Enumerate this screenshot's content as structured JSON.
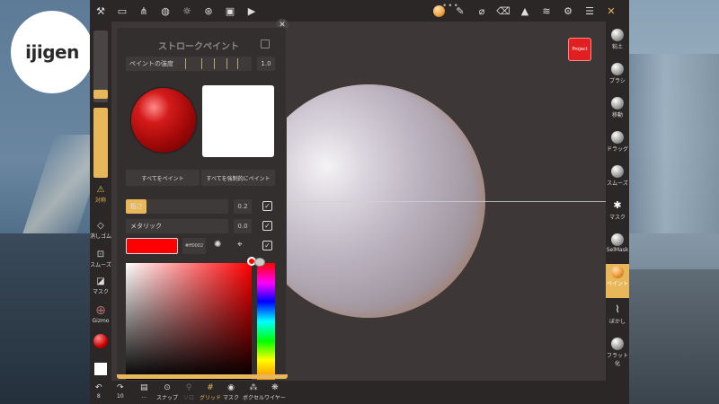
{
  "logo": {
    "text": "ijigen"
  },
  "topbar": {
    "icons": [
      "tools-icon",
      "folder-icon",
      "share-icon",
      "globe-icon",
      "sun-icon",
      "film-icon",
      "image-icon",
      "camera-icon"
    ],
    "right_icons": [
      "matcap-icon",
      "pen-icon",
      "pipette-icon",
      "trash-icon",
      "triangle-icon",
      "layers-icon",
      "gear-icon",
      "sliders-icon",
      "wand-icon"
    ],
    "more": "•••"
  },
  "viewport": {
    "project_label": "Project"
  },
  "panel": {
    "title": "ストロークペイント",
    "intensity_label": "ペイントの強度",
    "intensity_value": "1.0",
    "paint_all": "すべてをペイント",
    "force_paint_all": "すべてを強制的にペイント",
    "roughness_label": "粗さ",
    "roughness_value": "0.2",
    "roughness": 0.2,
    "metallic_label": "メタリック",
    "metallic_value": "0.0",
    "color_hex": "#ff0002",
    "check_mark": "✓"
  },
  "left_tools": {
    "symmetry": "対称",
    "eraser": "消しゴム",
    "smooth": "スムーズ",
    "mask": "マスク",
    "gizmo": "Gizmo"
  },
  "right_tools": [
    {
      "label": "粘土",
      "active": false
    },
    {
      "label": "ブラシ",
      "active": false
    },
    {
      "label": "移動",
      "active": false
    },
    {
      "label": "ドラッグ",
      "active": false
    },
    {
      "label": "スムーズ",
      "active": false
    },
    {
      "label": "マスク",
      "active": false
    },
    {
      "label": "SelMask",
      "active": false
    },
    {
      "label": "ペイント",
      "active": true
    },
    {
      "label": "ぼかし",
      "active": false
    },
    {
      "label": "フラット化",
      "active": false
    }
  ],
  "bottom": {
    "undo_count": "8",
    "redo_count": "10",
    "snap": "スナップ",
    "solo": "ソロ",
    "grid": "グリッド",
    "mask": "マスク",
    "voxel": "ボクセル",
    "wireframe": "ワイヤー",
    "dots": "..."
  },
  "colors": {
    "accent": "#e7b75a",
    "paint": "#ff0002"
  }
}
